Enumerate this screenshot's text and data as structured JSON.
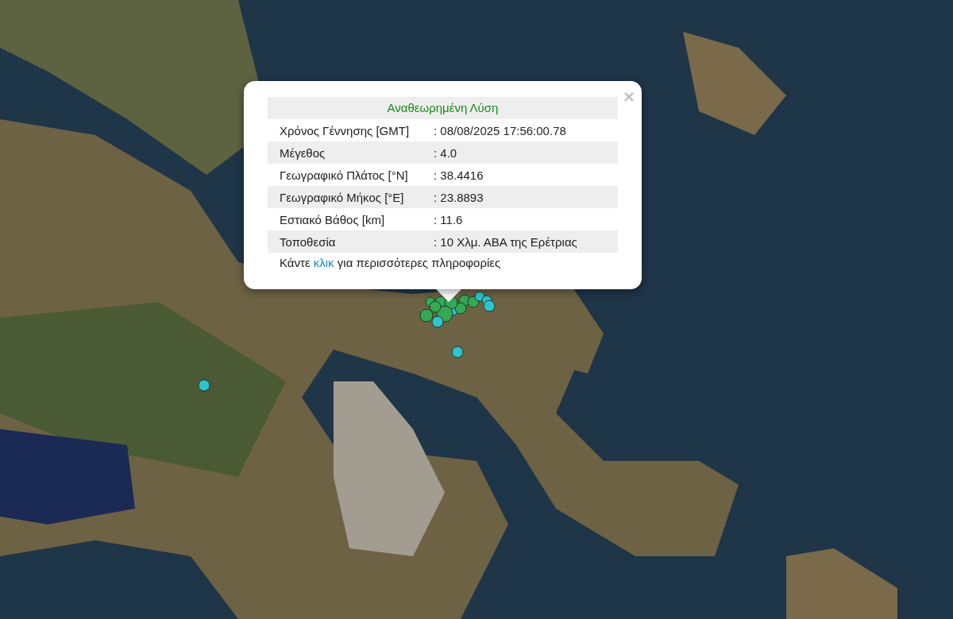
{
  "popup": {
    "title": "Αναθεωρημένη Λύση",
    "close": "×",
    "rows": [
      {
        "label": "Χρόνος Γέννησης [GMT]",
        "value": ": 08/08/2025 17:56:00.78"
      },
      {
        "label": "Μέγεθος",
        "value": ": 4.0"
      },
      {
        "label": "Γεωγραφικό Πλάτος [°N]",
        "value": ": 38.4416"
      },
      {
        "label": "Γεωγραφικό Μήκος [°E]",
        "value": ": 23.8893"
      },
      {
        "label": "Εστιακό Βάθος [km]",
        "value": ": 11.6"
      },
      {
        "label": "Τοποθεσία",
        "value": ": 10 Χλμ. ΑΒΑ της Ερέτριας"
      }
    ],
    "footer": {
      "before": "Κάντε",
      "link": "κλικ",
      "after": "για περισσότερες πληροφορίες"
    }
  },
  "markers": [
    {
      "color": "#2ec4d0"
    },
    {
      "color": "#2ec4d0"
    },
    {
      "color": "#2ec4d0"
    },
    {
      "color": "#2ec4d0"
    },
    {
      "color": "#2ec4d0"
    },
    {
      "color": "#2ec4d0"
    },
    {
      "color": "#35a853"
    },
    {
      "color": "#35a853"
    },
    {
      "color": "#35a853"
    },
    {
      "color": "#35a853"
    },
    {
      "color": "#35a853"
    },
    {
      "color": "#35a853"
    },
    {
      "color": "#35a853"
    },
    {
      "color": "#35a853"
    },
    {
      "color": "#35a853"
    },
    {
      "color": "#2ec4d0"
    }
  ]
}
